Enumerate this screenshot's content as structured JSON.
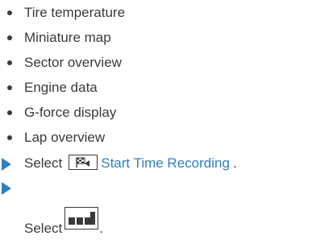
{
  "bullets": [
    "Tire temperature",
    "Miniature map",
    "Sector overview",
    "Engine data",
    "G-force display",
    "Lap overview"
  ],
  "step1": {
    "verb": "Select",
    "icon": "flag-timer-icon",
    "link": "Start Time Recording",
    "end": "."
  },
  "step2": {
    "verb": "Select",
    "icon": "layout-blocks-icon",
    "end": "."
  },
  "colors": {
    "text": "#3a3a3a",
    "accent": "#2e7fc0"
  }
}
